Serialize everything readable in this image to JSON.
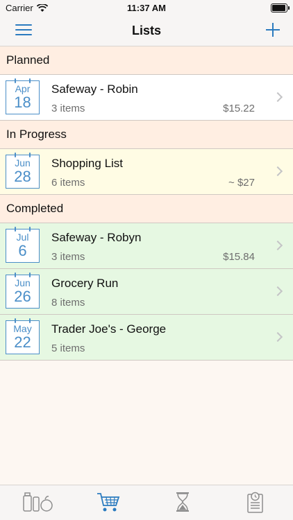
{
  "status": {
    "carrier": "Carrier",
    "time": "11:37 AM"
  },
  "nav": {
    "title": "Lists",
    "menu_icon": "hamburger-menu-icon",
    "add_icon": "plus-icon"
  },
  "colors": {
    "accent": "#2b7bbf",
    "planned_bg": "#ffffff",
    "progress_bg": "#fffce4",
    "done_bg": "#e6f8e2",
    "header_bg": "#ffeee2"
  },
  "sections": [
    {
      "title": "Planned",
      "items": [
        {
          "month": "Apr",
          "day": "18",
          "title": "Safeway - Robin",
          "count": "3 items",
          "price": "$15.22"
        }
      ]
    },
    {
      "title": "In Progress",
      "items": [
        {
          "month": "Jun",
          "day": "28",
          "title": "Shopping List",
          "count": "6 items",
          "price": "~ $27"
        }
      ]
    },
    {
      "title": "Completed",
      "items": [
        {
          "month": "Jul",
          "day": "6",
          "title": "Safeway - Robyn",
          "count": "3 items",
          "price": "$15.84"
        },
        {
          "month": "Jun",
          "day": "26",
          "title": "Grocery Run",
          "count": "8 items",
          "price": ""
        },
        {
          "month": "May",
          "day": "22",
          "title": "Trader Joe's - George",
          "count": "5 items",
          "price": ""
        }
      ]
    }
  ],
  "tabs": [
    {
      "icon": "pantry-items-icon",
      "active": false
    },
    {
      "icon": "shopping-cart-icon",
      "active": true
    },
    {
      "icon": "hourglass-icon",
      "active": false
    },
    {
      "icon": "history-list-icon",
      "active": false
    }
  ]
}
